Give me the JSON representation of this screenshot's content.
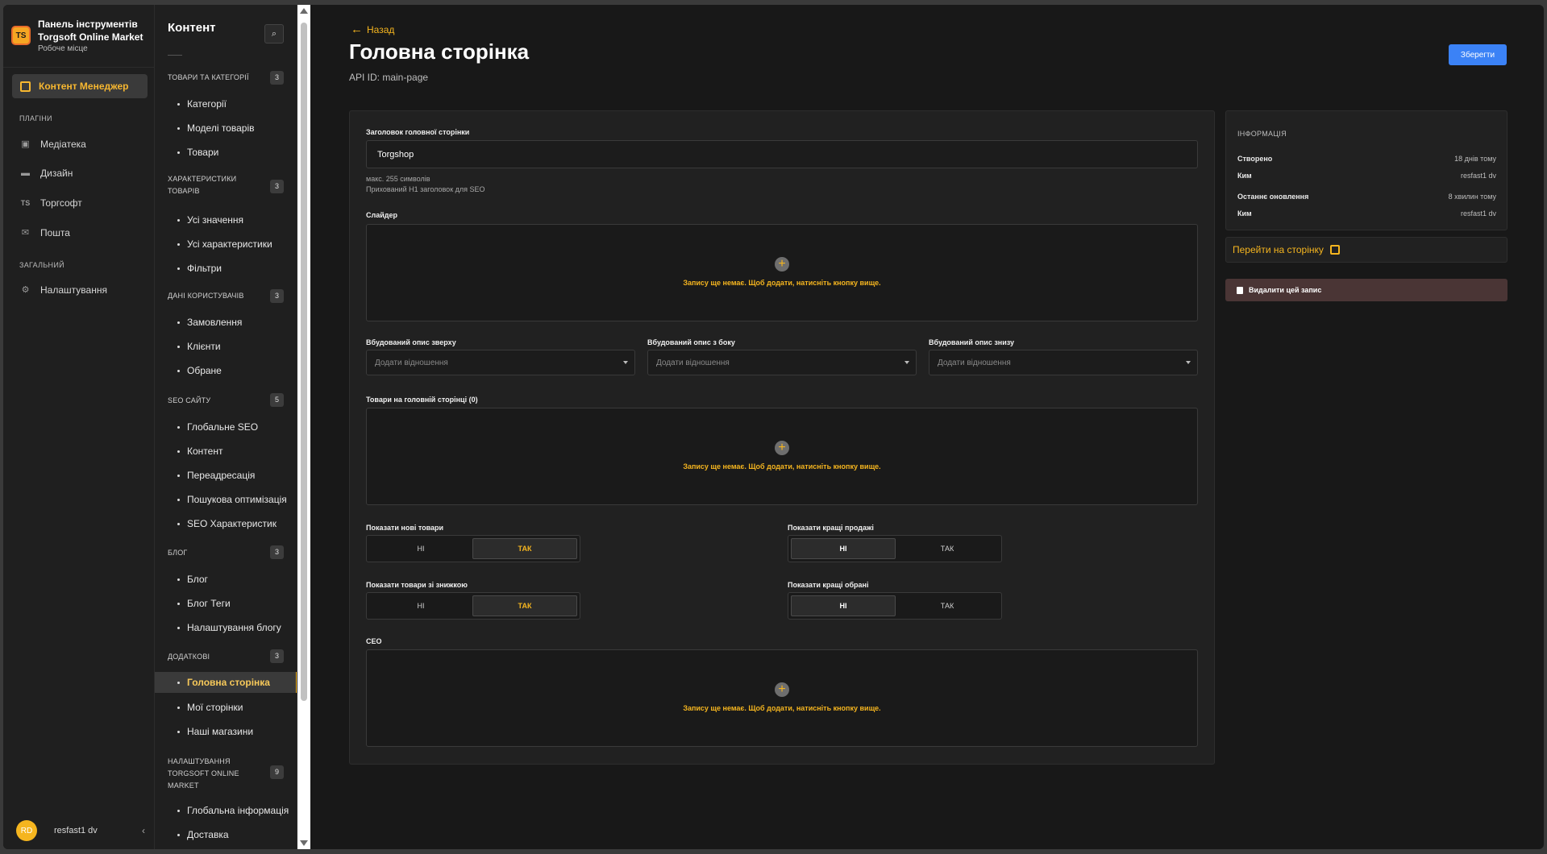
{
  "brand": {
    "logo": "TS",
    "title_line1": "Панель інструментів",
    "title_line2": "Torgsoft Online Market",
    "subtitle": "Робоче місце"
  },
  "mainnav": {
    "active": "Контент Менеджер",
    "plugins_label": "ПЛАГІНИ",
    "plugins": [
      {
        "label": "Медіатека",
        "icon": "image-icon"
      },
      {
        "label": "Дизайн",
        "icon": "paint-roller-icon"
      },
      {
        "label": "Торгсофт",
        "icon": "ts-icon"
      },
      {
        "label": "Пошта",
        "icon": "mail-icon"
      }
    ],
    "general_label": "ЗАГАЛЬНИЙ",
    "settings": "Налаштування",
    "user_initials": "RD",
    "user_name": "resfast1 dv",
    "collapse": "‹"
  },
  "subnav": {
    "title": "Контент",
    "groups": [
      {
        "label": "ТОВАРИ ТА КАТЕГОРІЇ",
        "count": "3",
        "items": [
          "Категорії",
          "Моделі товарів",
          "Товари"
        ]
      },
      {
        "label": "ХАРАКТЕРИСТИКИ ТОВАРІВ",
        "count": "3",
        "items": [
          "Усі значення",
          "Усі характеристики",
          "Фільтри"
        ]
      },
      {
        "label": "ДАНІ КОРИСТУВАЧІВ",
        "count": "3",
        "items": [
          "Замовлення",
          "Клієнти",
          "Обране"
        ]
      },
      {
        "label": "SEO САЙТУ",
        "count": "5",
        "items": [
          "Глобальне SEO",
          "Контент",
          "Переадресація",
          "Пошукова оптимізація",
          "SEO Характеристик"
        ]
      },
      {
        "label": "БЛОГ",
        "count": "3",
        "items": [
          "Блог",
          "Блог Теги",
          "Налаштування блогу"
        ]
      },
      {
        "label": "ДОДАТКОВІ",
        "count": "3",
        "items": [
          "Головна сторінка",
          "Мої сторінки",
          "Наші магазини"
        ]
      },
      {
        "label": "НАЛАШТУВАННЯ TORGSOFT ONLINE MARKET",
        "count": "9",
        "items": [
          "Глобальна інформація",
          "Доставка"
        ]
      }
    ]
  },
  "main": {
    "back": "Назад",
    "title": "Головна сторінка",
    "api_id": "API ID: main-page",
    "save": "Зберегти",
    "heading_label": "Заголовок головної сторінки",
    "heading_value": "Torgshop",
    "heading_hint1": "макс. 255 символів",
    "heading_hint2": "Прихований H1 заголовок для SEO",
    "slider_label": "Слайдер",
    "empty_text": "Запису ще немає. Щоб додати, натисніть кнопку вище.",
    "rel_top_label": "Вбудований опис зверху",
    "rel_side_label": "Вбудований опис з боку",
    "rel_bottom_label": "Вбудований опис знизу",
    "rel_placeholder": "Додати відношення",
    "products_label": "Товари на головній сторінці (0)",
    "show_new_label": "Показати нові товари",
    "show_best_sales_label": "Показати кращі продажі",
    "show_discount_label": "Показати товари зі знижкою",
    "show_best_fav_label": "Показати кращі обрані",
    "opt_no": "НІ",
    "opt_yes": "ТАК",
    "seo_label": "СЕО"
  },
  "info": {
    "head": "ІНФОРМАЦІЯ",
    "created_k": "Створено",
    "created_v": "18 днів тому",
    "by1_k": "Ким",
    "by1_v": "resfast1 dv",
    "updated_k": "Останнє оновлення",
    "updated_v": "8 хвилин тому",
    "by2_k": "Ким",
    "by2_v": "resfast1 dv",
    "goto": "Перейти на сторінку",
    "delete": "Видалити цей запис"
  },
  "colors": {
    "accent": "#f5b51f",
    "primary": "#3b82f6",
    "danger_bg": "#4a3535"
  }
}
